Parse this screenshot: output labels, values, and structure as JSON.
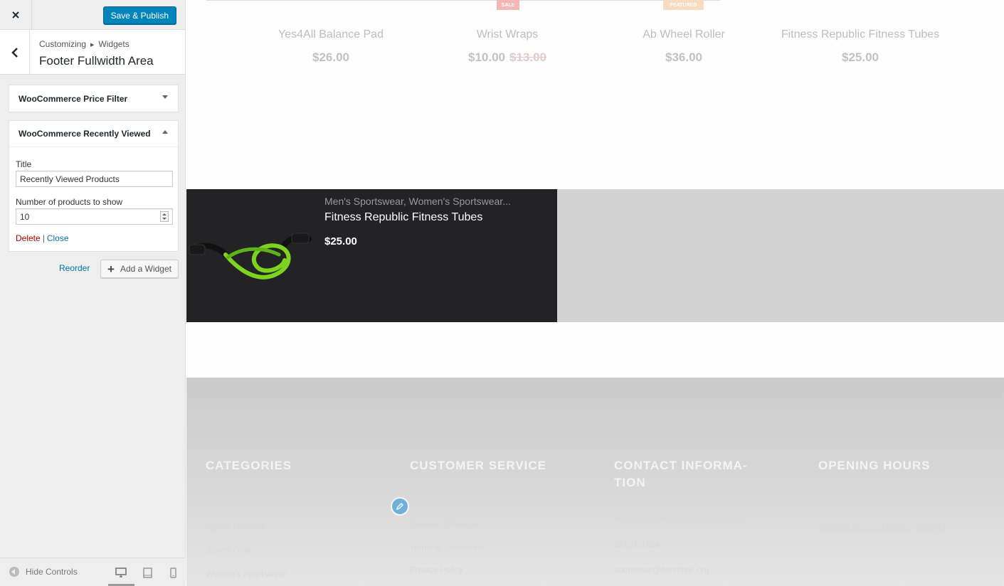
{
  "topbar": {
    "publish_label": "Save & Publish"
  },
  "section": {
    "breadcrumb_parent": "Customizing",
    "breadcrumb_child": "Widgets",
    "title": "Footer Fullwidth Area"
  },
  "widgets": [
    {
      "title": "WooCommerce Price Filter",
      "expanded": false
    },
    {
      "title": "WooCommerce Recently Viewed",
      "expanded": true
    }
  ],
  "recent_widget_form": {
    "title_label": "Title",
    "title_value": "Recently Viewed Products",
    "count_label": "Number of products to show",
    "count_value": "10",
    "delete_label": "Delete",
    "separator": "|",
    "close_label": "Close"
  },
  "widget_area_actions": {
    "reorder_label": "Reorder",
    "add_label": "Add a Widget"
  },
  "footer_controls": {
    "hide_label": "Hide Controls"
  },
  "preview": {
    "badges": {
      "sale": "SALE",
      "featured": "FEATURED"
    },
    "products": [
      {
        "name": "Yes4All Balance Pad",
        "price": "$26.00"
      },
      {
        "name": "Wrist Wraps",
        "price": "$10.00",
        "old_price": "$13.00"
      },
      {
        "name": "Ab Wheel Roller",
        "price": "$36.00"
      },
      {
        "name": "Fitness Republic Fitness Tubes",
        "price": "$25.00"
      }
    ],
    "recently_viewed": {
      "categories": "Men's Sportswear, Women's Sportswear...",
      "name": "Fitness Republic Fitness Tubes",
      "price": "$25.00"
    },
    "footer": {
      "categories": {
        "heading": "CATEGORIES",
        "links": [
          "Men's Sportswear",
          "Sports Fanwear",
          "Sports Gear",
          "Women's Sportswear"
        ]
      },
      "customer_service": {
        "heading": "CUSTOMER SERVICE",
        "links": [
          "About us",
          "Delivery & Returns",
          "Terms & Conditions",
          "Privacy Policy"
        ]
      },
      "contact": {
        "heading_line1": "CONTACT INFORMA-",
        "heading_line2": "TION",
        "address_line1": "4096 N Highland St, Arlington, VA",
        "address_line2": "32101, USA",
        "email": "sportwear@dercelink.org"
      },
      "hours": {
        "heading": "OPENING HOURS",
        "line1": "Working Days: Mon. - Fri.",
        "line2": "Working Hours: 9.00AM - 6.00PM"
      }
    }
  },
  "colors": {
    "accent": "#0085ba",
    "link": "#0073aa",
    "delete": "#aa0000",
    "product_accent": "#7ed321"
  }
}
